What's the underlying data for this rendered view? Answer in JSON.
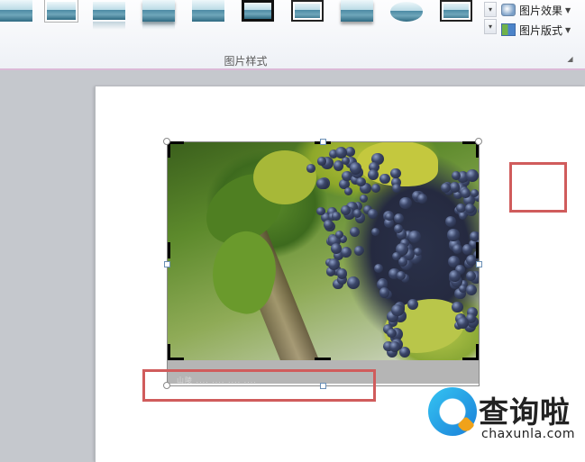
{
  "ribbon": {
    "picture_styles": {
      "group_label": "图片样式",
      "styles": [
        {
          "id": 1,
          "icon": "simple-frame-style"
        },
        {
          "id": 2,
          "icon": "white-frame-style"
        },
        {
          "id": 3,
          "icon": "soft-edge-style"
        },
        {
          "id": 4,
          "icon": "reflection-style"
        },
        {
          "id": 5,
          "icon": "reflection-rounded-style"
        },
        {
          "id": 6,
          "icon": "thick-black-frame-style"
        },
        {
          "id": 7,
          "icon": "black-frame-style"
        },
        {
          "id": 8,
          "icon": "shadow-style"
        },
        {
          "id": 9,
          "icon": "oval-style"
        },
        {
          "id": 10,
          "icon": "metal-frame-style"
        }
      ]
    },
    "commands": {
      "picture_effects": "图片效果",
      "picture_layout": "图片版式"
    }
  },
  "slide": {
    "picture": {
      "icon": "grapes-photo",
      "caption_overlay": "山陵 .... .... .... ...."
    }
  },
  "watermark": {
    "brand": "查询啦",
    "url": "chaxunla.com"
  }
}
